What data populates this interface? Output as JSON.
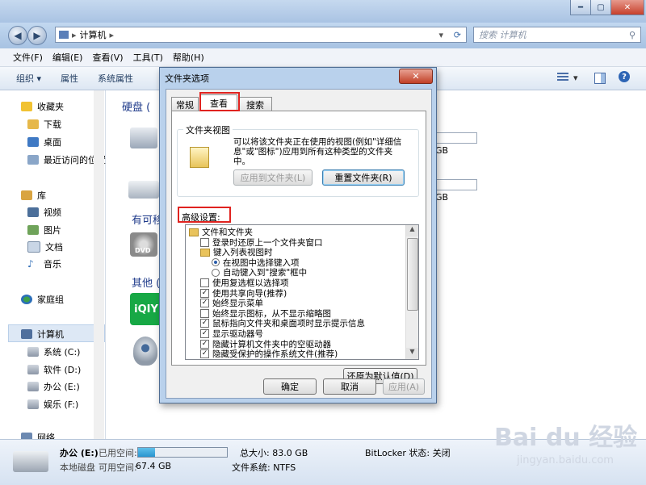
{
  "window": {
    "address_path": "计算机",
    "search_placeholder": "搜索 计算机"
  },
  "menu": [
    "文件(F)",
    "编辑(E)",
    "查看(V)",
    "工具(T)",
    "帮助(H)"
  ],
  "toolbar": [
    "组织 ▾",
    "属性",
    "系统属性"
  ],
  "sidebar": {
    "favorites": "收藏夹",
    "downloads": "下载",
    "desktop": "桌面",
    "recent": "最近访问的位置",
    "libraries": "库",
    "videos": "视频",
    "pictures": "图片",
    "documents": "文档",
    "music": "音乐",
    "homegroup": "家庭组",
    "computer": "计算机",
    "drive_c": "系统 (C:)",
    "drive_d": "软件 (D:)",
    "drive_e": "办公 (E:)",
    "drive_f": "娱乐 (F:)",
    "network": "网络"
  },
  "content": {
    "group_hdd": "硬盘 (",
    "group_removable": "有可移",
    "group_other": "其他 (",
    "size_1": "GB",
    "size_2": "GB",
    "dvd_label": "DVD"
  },
  "status": {
    "drive_name": "办公 (E:)",
    "drive_type": "本地磁盘",
    "free_label": "可用空间:",
    "free_value": "67.4 GB",
    "used_label": "已用空间:",
    "used_fraction": 0.19,
    "total": "总大小: 83.0 GB",
    "fs": "文件系统: NTFS",
    "bitlocker": "BitLocker 状态: 关闭"
  },
  "dialog": {
    "title": "文件夹选项",
    "close": "✕",
    "tabs": [
      "常规",
      "查看",
      "搜索"
    ],
    "folder_views_title": "文件夹视图",
    "folder_views_desc": "可以将该文件夹正在使用的视图(例如\"详细信息\"或\"图标\")应用到所有这种类型的文件夹中。",
    "apply_to_folders": "应用到文件夹(L)",
    "reset_folders": "重置文件夹(R)",
    "advanced_label": "高级设置:",
    "tree": [
      {
        "type": "folder",
        "label": "文件和文件夹",
        "indent": 0
      },
      {
        "type": "checkbox",
        "label": "登录时还原上一个文件夹窗口",
        "checked": false,
        "indent": 1
      },
      {
        "type": "folder",
        "label": "键入列表视图时",
        "indent": 1
      },
      {
        "type": "radio",
        "label": "在视图中选择键入项",
        "checked": true,
        "indent": 2
      },
      {
        "type": "radio",
        "label": "自动键入到\"搜索\"框中",
        "checked": false,
        "indent": 2
      },
      {
        "type": "checkbox",
        "label": "使用复选框以选择项",
        "checked": false,
        "indent": 1
      },
      {
        "type": "checkbox",
        "label": "使用共享向导(推荐)",
        "checked": true,
        "indent": 1
      },
      {
        "type": "checkbox",
        "label": "始终显示菜单",
        "checked": true,
        "indent": 1
      },
      {
        "type": "checkbox",
        "label": "始终显示图标，从不显示缩略图",
        "checked": false,
        "indent": 1
      },
      {
        "type": "checkbox",
        "label": "鼠标指向文件夹和桌面项时显示提示信息",
        "checked": true,
        "indent": 1
      },
      {
        "type": "checkbox",
        "label": "显示驱动器号",
        "checked": true,
        "indent": 1
      },
      {
        "type": "checkbox",
        "label": "隐藏计算机文件夹中的空驱动器",
        "checked": true,
        "indent": 1
      },
      {
        "type": "checkbox",
        "label": "隐藏受保护的操作系统文件(推荐)",
        "checked": true,
        "indent": 1
      }
    ],
    "restore_defaults": "还原为默认值(D)",
    "ok": "确定",
    "cancel": "取消",
    "apply": "应用(A)"
  },
  "watermark": {
    "brand": "Bai du 经验",
    "url": "jingyan.baidu.com"
  },
  "colors": {
    "highlight_red": "#e0231f",
    "link_blue": "#1e3a8a"
  }
}
